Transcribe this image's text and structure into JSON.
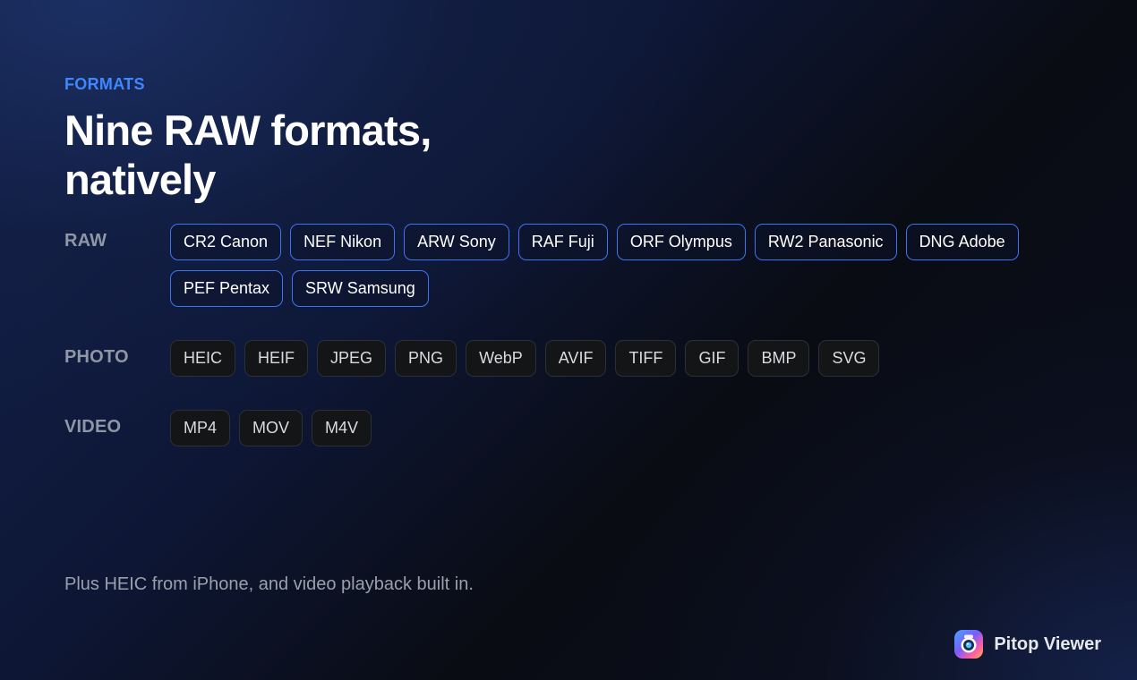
{
  "section": {
    "eyebrow": "FORMATS",
    "headline_line1": "Nine RAW formats,",
    "headline_line2": "natively"
  },
  "groups": {
    "raw": {
      "label": "RAW",
      "formats": [
        "CR2 Canon",
        "NEF Nikon",
        "ARW Sony",
        "RAF Fuji",
        "ORF Olympus",
        "RW2 Panasonic",
        "DNG Adobe",
        "PEF Pentax",
        "SRW Samsung"
      ]
    },
    "photo": {
      "label": "PHOTO",
      "formats": [
        "HEIC",
        "HEIF",
        "JPEG",
        "PNG",
        "WebP",
        "AVIF",
        "TIFF",
        "GIF",
        "BMP",
        "SVG"
      ]
    },
    "video": {
      "label": "VIDEO",
      "formats": [
        "MP4",
        "MOV",
        "M4V"
      ]
    }
  },
  "footnote": "Plus HEIC from iPhone, and video playback built in.",
  "brand": {
    "name": "Pitop Viewer",
    "logo_icon": "camera-lens-icon"
  },
  "colors": {
    "accent": "#3f86ff",
    "raw_chip_border": "#3e74f0",
    "plain_chip_border": "#2b2f37"
  }
}
